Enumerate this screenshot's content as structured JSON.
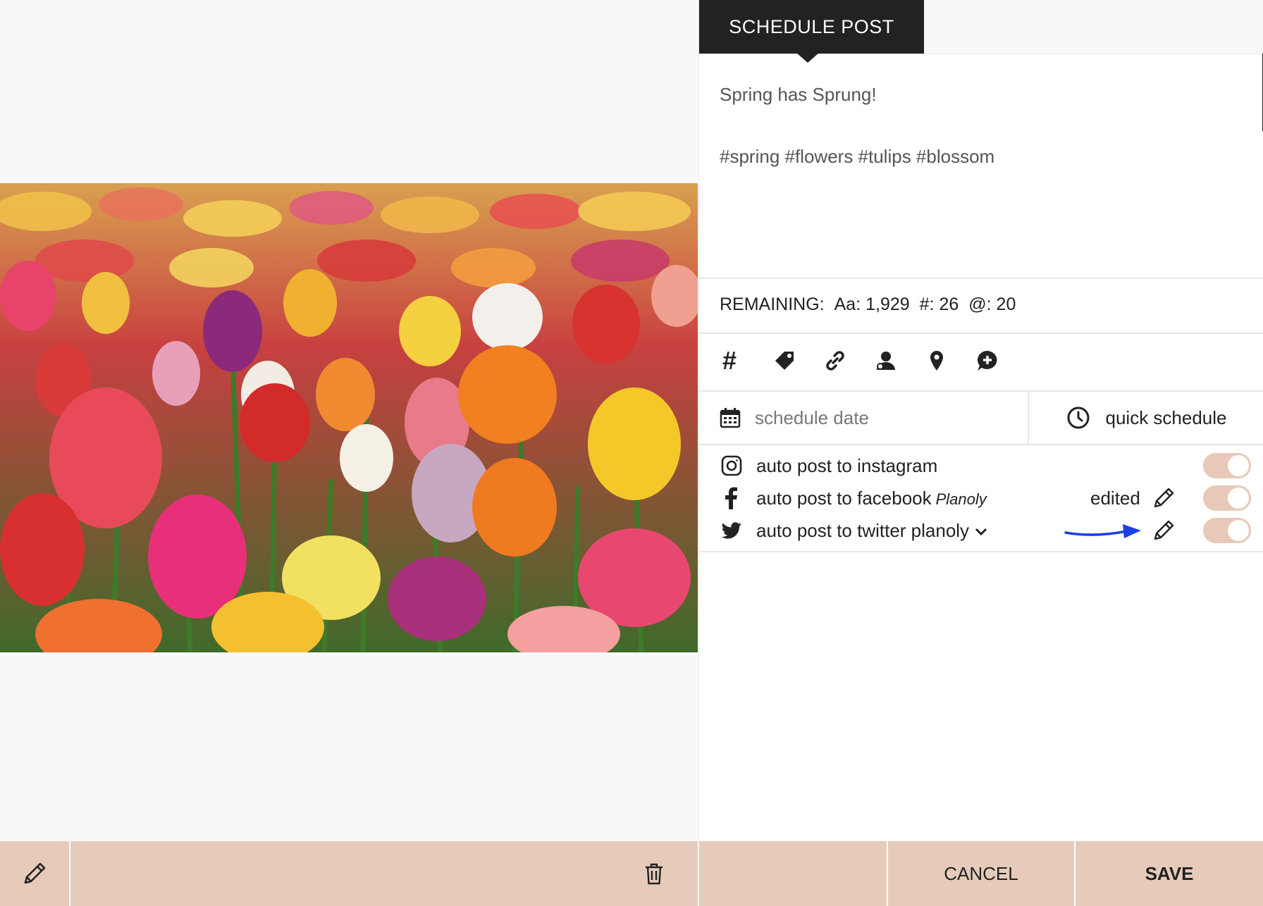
{
  "header": {
    "tab_label": "SCHEDULE POST"
  },
  "media": {
    "icon": "tulip-field-photo"
  },
  "caption": {
    "line1": "Spring has Sprung!",
    "line2": "#spring #flowers #tulips #blossom"
  },
  "remaining": {
    "prefix": "REMAINING:",
    "chars": "Aa: 1,929",
    "hashtags": "#: 26",
    "mentions": "@: 20"
  },
  "tools": {
    "hashtag": "#",
    "icons": [
      "tag-icon",
      "link-icon",
      "user-tag-icon",
      "location-icon",
      "comment-add-icon"
    ]
  },
  "schedule": {
    "date_placeholder": "schedule date",
    "quick_label": "quick schedule"
  },
  "posting": {
    "instagram_label": "auto post to instagram",
    "facebook_label": "auto post to facebook",
    "facebook_account": "Planoly",
    "facebook_status": "edited",
    "twitter_label": "auto post to twitter planoly"
  },
  "colors": {
    "accent": "#e6cbbb",
    "toggle": "#e8c8b8",
    "tab_bg": "#222222",
    "arrow": "#1a3ee8"
  },
  "footer": {
    "cancel_label": "CANCEL",
    "save_label": "SAVE"
  }
}
